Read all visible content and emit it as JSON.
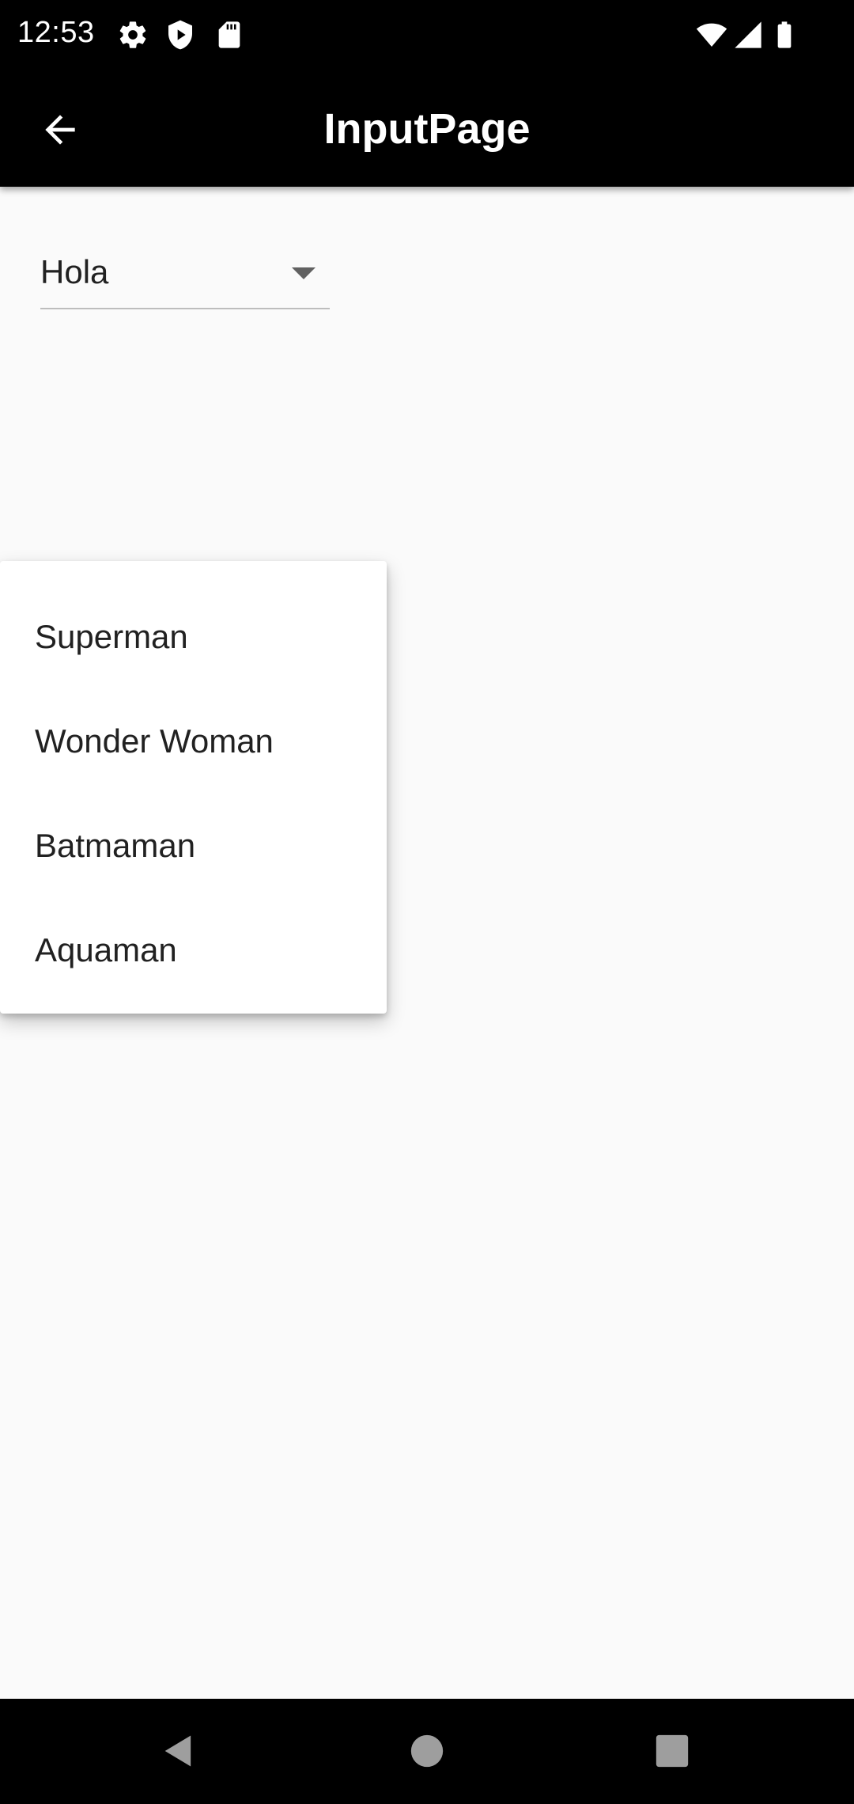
{
  "status_bar": {
    "time": "12:53",
    "left_icons": [
      "settings-icon",
      "shield-play-icon",
      "sd-card-icon"
    ],
    "right_icons": [
      "wifi-icon",
      "cellular-signal-icon",
      "battery-icon"
    ]
  },
  "app_bar": {
    "title": "InputPage",
    "back_icon": "arrow-back-icon"
  },
  "dropdown": {
    "selected_value": "Hola",
    "arrow_icon": "arrow-drop-down-icon"
  },
  "menu": {
    "items": [
      {
        "label": "Superman"
      },
      {
        "label": "Wonder Woman"
      },
      {
        "label": "Batmaman"
      },
      {
        "label": "Aquaman"
      }
    ]
  },
  "nav_bar": {
    "buttons": [
      "back-triangle-icon",
      "home-circle-icon",
      "recents-square-icon"
    ]
  },
  "colors": {
    "app_bar": "#000000",
    "background": "#fafafa",
    "menu": "#ffffff",
    "text": "#212121"
  }
}
